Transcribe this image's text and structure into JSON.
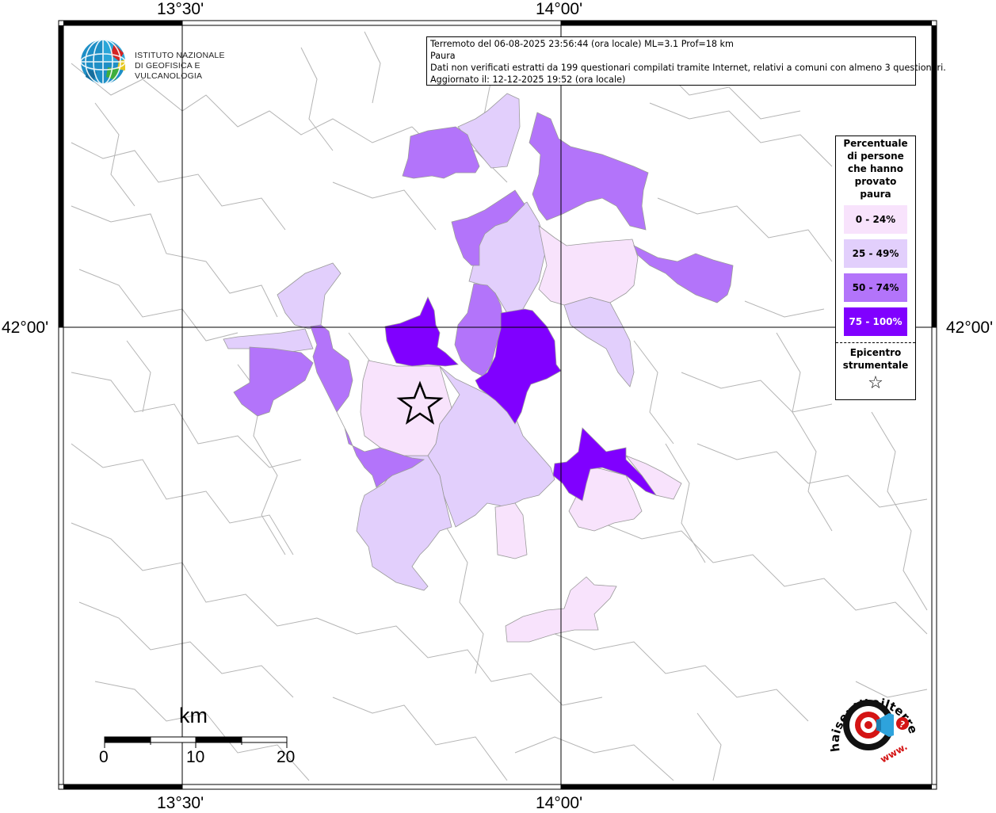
{
  "axes": {
    "top_labels": [
      "13°30'",
      "14°00'"
    ],
    "bottom_labels": [
      "13°30'",
      "14°00'"
    ],
    "left_label": "42°00'",
    "right_label": "42°00'"
  },
  "info": {
    "line1": "Terremoto del 06-08-2025 23:56:44 (ora locale) ML=3.1 Prof=18 km",
    "line2": "Paura",
    "line3": "Dati non verificati estratti da 199 questionari compilati tramite Internet, relativi a comuni con almeno 3 questionari.",
    "line4": "Aggiornato il: 12-12-2025 19:52 (ora locale)"
  },
  "legend": {
    "title_lines": [
      "Percentuale",
      "di persone",
      "che hanno",
      "provato",
      "paura"
    ],
    "classes": [
      {
        "label": "0 - 24%",
        "color": "#f8e3fc",
        "text_color": "#000000"
      },
      {
        "label": "25 - 49%",
        "color": "#e2cffc",
        "text_color": "#000000"
      },
      {
        "label": "50 - 74%",
        "color": "#b374fa",
        "text_color": "#000000"
      },
      {
        "label": "75 - 100%",
        "color": "#8000ff",
        "text_color": "#ffffff"
      }
    ],
    "epicenter_lines": [
      "Epicentro",
      "strumentale"
    ],
    "epicenter_symbol": "☆"
  },
  "logo_ingv": {
    "line1": "ISTITUTO NAZIONALE",
    "line2": "DI GEOFISICA E VULCANOLOGIA"
  },
  "scale": {
    "title": "km",
    "ticks": [
      "0",
      "10",
      "20"
    ]
  },
  "logo_hst": {
    "text": "haisentitoilterremoto.it",
    "prefix": "www.",
    "icon": "speaker-target-icon"
  },
  "colors": {
    "boundary": "#b4b4b4",
    "grid": "#000000",
    "epicenter": "#000000"
  }
}
